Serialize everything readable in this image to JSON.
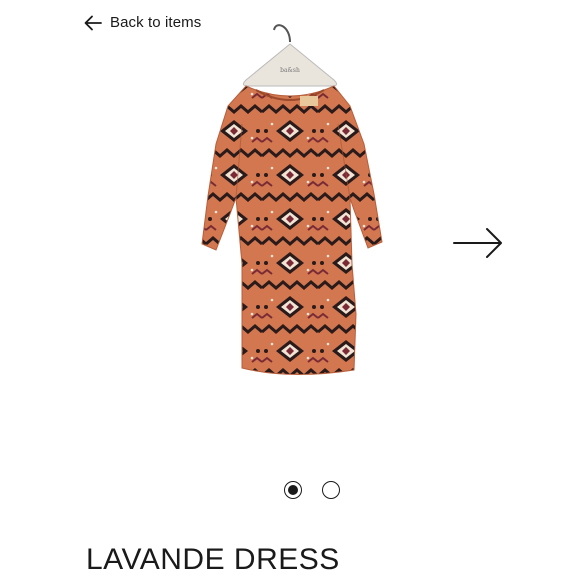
{
  "nav": {
    "back_label": "Back to items",
    "back_icon": "arrow-left-icon",
    "next_icon": "arrow-right-icon"
  },
  "product": {
    "name": "LAVANDE DRESS",
    "hanger_brand": "ba&sh",
    "image_subject": "dress-on-hanger",
    "colors": {
      "base": "#d2774f",
      "pattern_dark": "#2a1a1a",
      "pattern_accent": "#7a2a35",
      "pattern_light": "#f1e4d4"
    }
  },
  "pager": {
    "count": 2,
    "active_index": 0,
    "dot_icon": "radio-dot-icon"
  }
}
